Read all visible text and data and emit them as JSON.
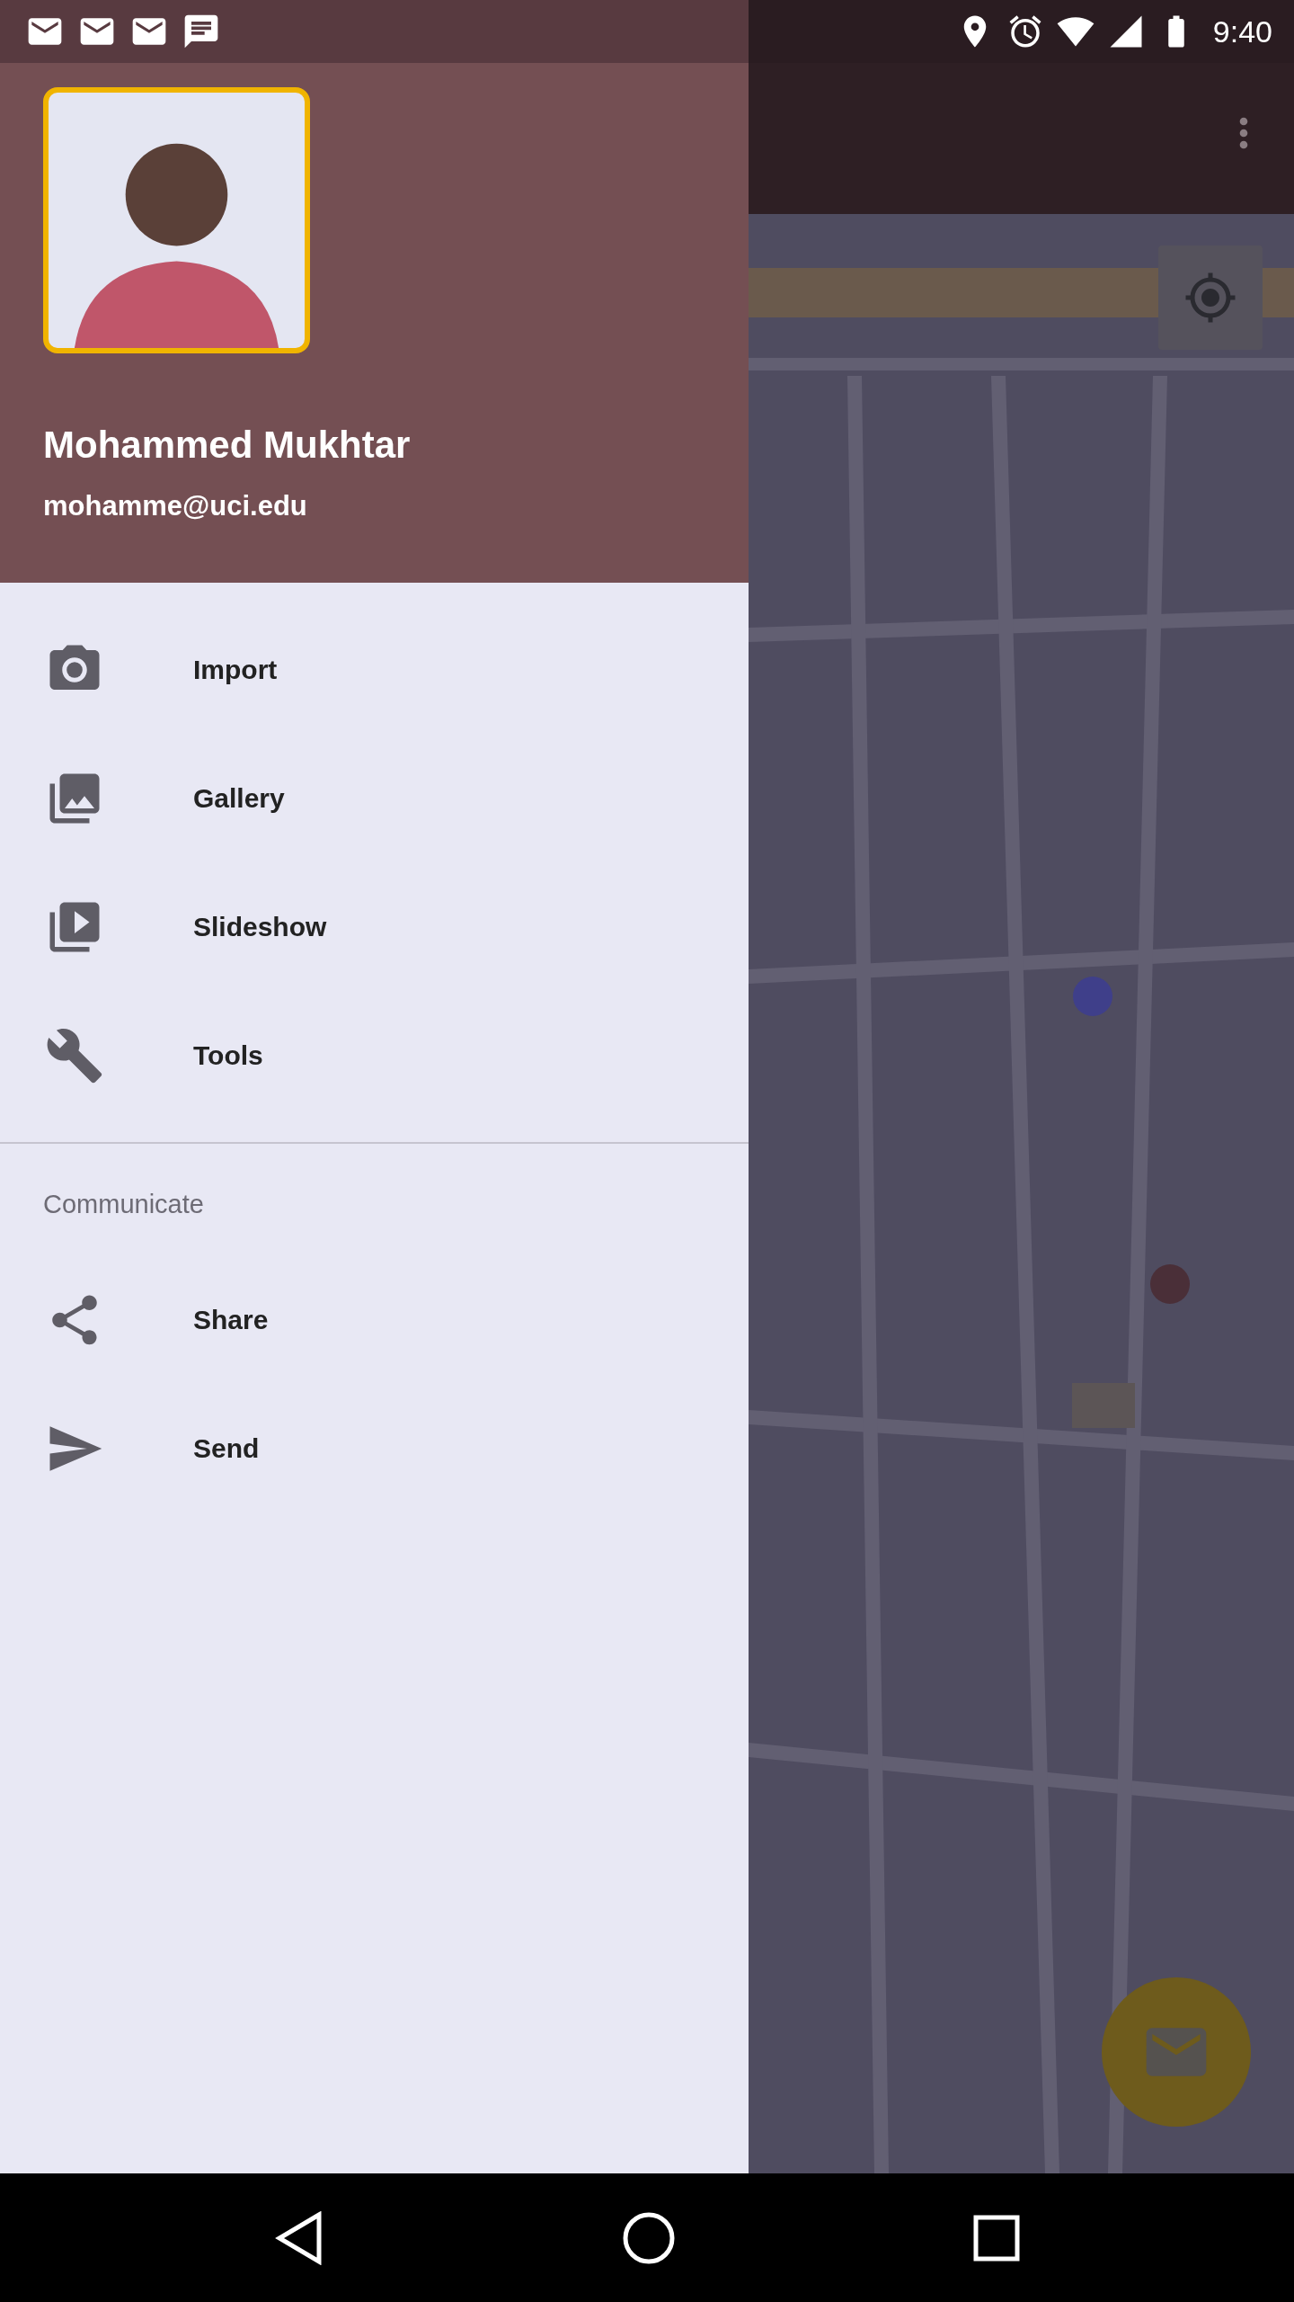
{
  "status_bar": {
    "time": "9:40"
  },
  "drawer": {
    "header": {
      "name": "Mohammed Mukhtar",
      "email": "mohamme@uci.edu"
    },
    "sections": [
      {
        "items": [
          {
            "label": "Import"
          },
          {
            "label": "Gallery"
          },
          {
            "label": "Slideshow"
          },
          {
            "label": "Tools"
          }
        ]
      },
      {
        "title": "Communicate",
        "items": [
          {
            "label": "Share"
          },
          {
            "label": "Send"
          }
        ]
      }
    ]
  }
}
